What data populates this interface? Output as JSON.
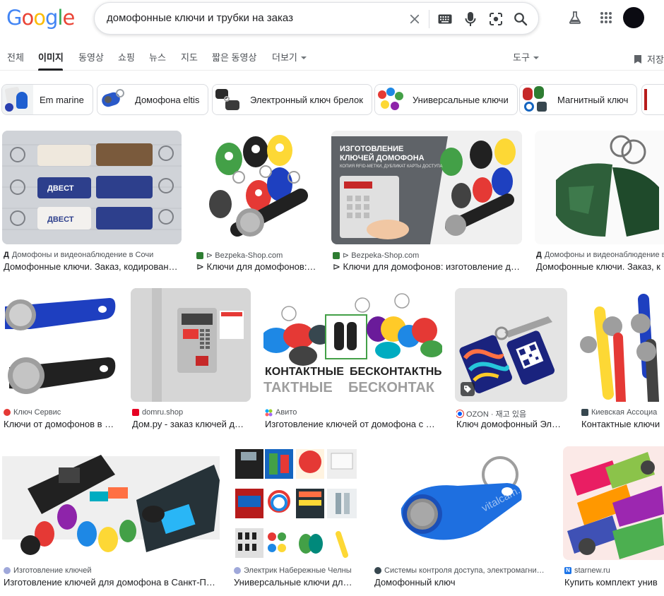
{
  "header": {
    "logo": [
      "G",
      "o",
      "o",
      "g",
      "l",
      "e"
    ],
    "logo_colors": [
      "#4285F4",
      "#EA4335",
      "#FBBC05",
      "#4285F4",
      "#34A853",
      "#EA4335"
    ],
    "search_query": "домофонные ключи и трубки на заказ",
    "icons": [
      "clear-icon",
      "keyboard-icon",
      "microphone-icon",
      "lens-icon",
      "search-icon",
      "labs-icon",
      "apps-icon"
    ]
  },
  "tabs": {
    "items": [
      "전체",
      "이미지",
      "동영상",
      "쇼핑",
      "뉴스",
      "지도",
      "짧은 동영상",
      "더보기"
    ],
    "active": "이미지",
    "tools": "도구",
    "save": "저장"
  },
  "chips": [
    {
      "label": "Em marine"
    },
    {
      "label": "Домофона eltis"
    },
    {
      "label": "Электронный ключ брелок"
    },
    {
      "label": "Универсальные ключи"
    },
    {
      "label": "Магнитный ключ"
    }
  ],
  "results": [
    {
      "source": "Домофоны и видеонаблюдение в Сочи",
      "title": "Домофонные ключи. Заказ, кодирован…",
      "fav": "Д"
    },
    {
      "source": "⊳ Bezpeka-Shop.com",
      "title": "⊳ Ключи для домофонов:…"
    },
    {
      "source": "⊳ Bezpeka-Shop.com",
      "title": "⊳ Ключи для домофонов: изготовление д…",
      "overlay_title": "ИЗГОТОВЛЕНИЕ КЛЮЧЕЙ ДОМОФОНА",
      "overlay_sub": "КОПИЯ RFID-МЕТКИ, ДУБЛИКАТ КАРТЫ ДОСТУПА"
    },
    {
      "source": "Домофоны и видеонаблюдение в",
      "title": "Домофонные ключи. Заказ, к",
      "fav": "Д"
    },
    {
      "source": "Ключ Сервис",
      "title": "Ключи от домофонов в …"
    },
    {
      "source": "domru.shop",
      "title": "Дом.ру - заказ ключей д…"
    },
    {
      "source": "Авито",
      "title": "Изготовление ключей от домофона с …",
      "overlay_left": "КОНТАКТНЫЕ",
      "overlay_left2": "ТАКТНЫЕ",
      "overlay_right": "БЕСКОНТАКТНЫЕ",
      "overlay_right2": "БЕСКОНТАК"
    },
    {
      "source": "OZON · 재고 있음",
      "title": "Ключ домофонный Эл…"
    },
    {
      "source": "Киевская Ассоциа",
      "title": "Контактные ключи"
    },
    {
      "source": "Изготовление ключей",
      "title": "Изготовление ключей для домофона в Санкт-П…"
    },
    {
      "source": "Электрик Набережные Челны",
      "title": "Универсальные ключи дл…"
    },
    {
      "source": "Системы контроля доступа, электромагни…",
      "title": "Домофонный ключ",
      "watermark": "vitalcam.com"
    },
    {
      "source": "starnew.ru",
      "title": "Купить комплект унив",
      "fav": "N"
    }
  ],
  "colors": {
    "accent": "#1a73e8",
    "text": "#202124",
    "muted": "#4d5156",
    "border": "#dadce0"
  }
}
